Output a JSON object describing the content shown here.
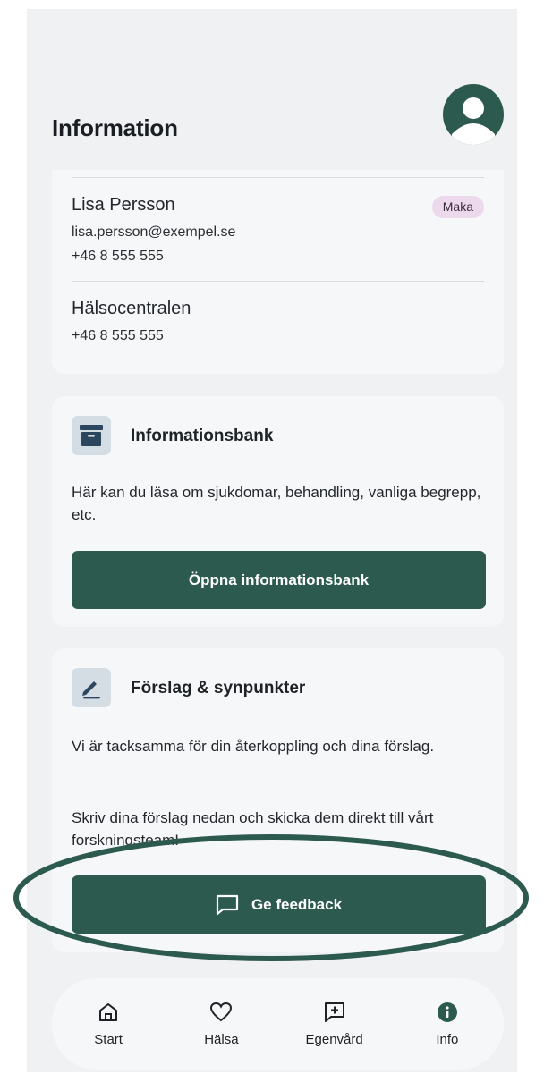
{
  "header": {
    "title": "Information"
  },
  "contacts": [
    {
      "name": "Lisa Persson",
      "badge": "Maka",
      "email": "lisa.persson@exempel.se",
      "phone": "+46 8 555 555"
    },
    {
      "name": "Hälsocentralen",
      "phone": "+46 8 555 555"
    }
  ],
  "info_card": {
    "icon": "archive-box-icon",
    "title": "Informationsbank",
    "text": "Här kan du läsa om sjukdomar, behandling, vanliga begrepp, etc.",
    "button_label": "Öppna informationsbank"
  },
  "feedback_card": {
    "icon": "pencil-icon",
    "title": "Förslag & synpunkter",
    "text1": "Vi är tacksamma för din återkoppling och dina förslag.",
    "text2": "Skriv dina förslag nedan och skicka dem direkt till vårt forskningsteam!",
    "button_icon": "chat-bubble-icon",
    "button_label": "Ge feedback"
  },
  "nav": [
    {
      "icon": "home-icon",
      "label": "Start"
    },
    {
      "icon": "heart-icon",
      "label": "Hälsa"
    },
    {
      "icon": "plus-message-icon",
      "label": "Egenvård"
    },
    {
      "icon": "info-icon",
      "label": "Info",
      "active": true
    }
  ],
  "colors": {
    "primary": "#2d5a4f",
    "background": "#eff1f3",
    "card": "#f6f7f9",
    "badge": "#ecd9ec",
    "annotation": "#2d5a4f"
  }
}
